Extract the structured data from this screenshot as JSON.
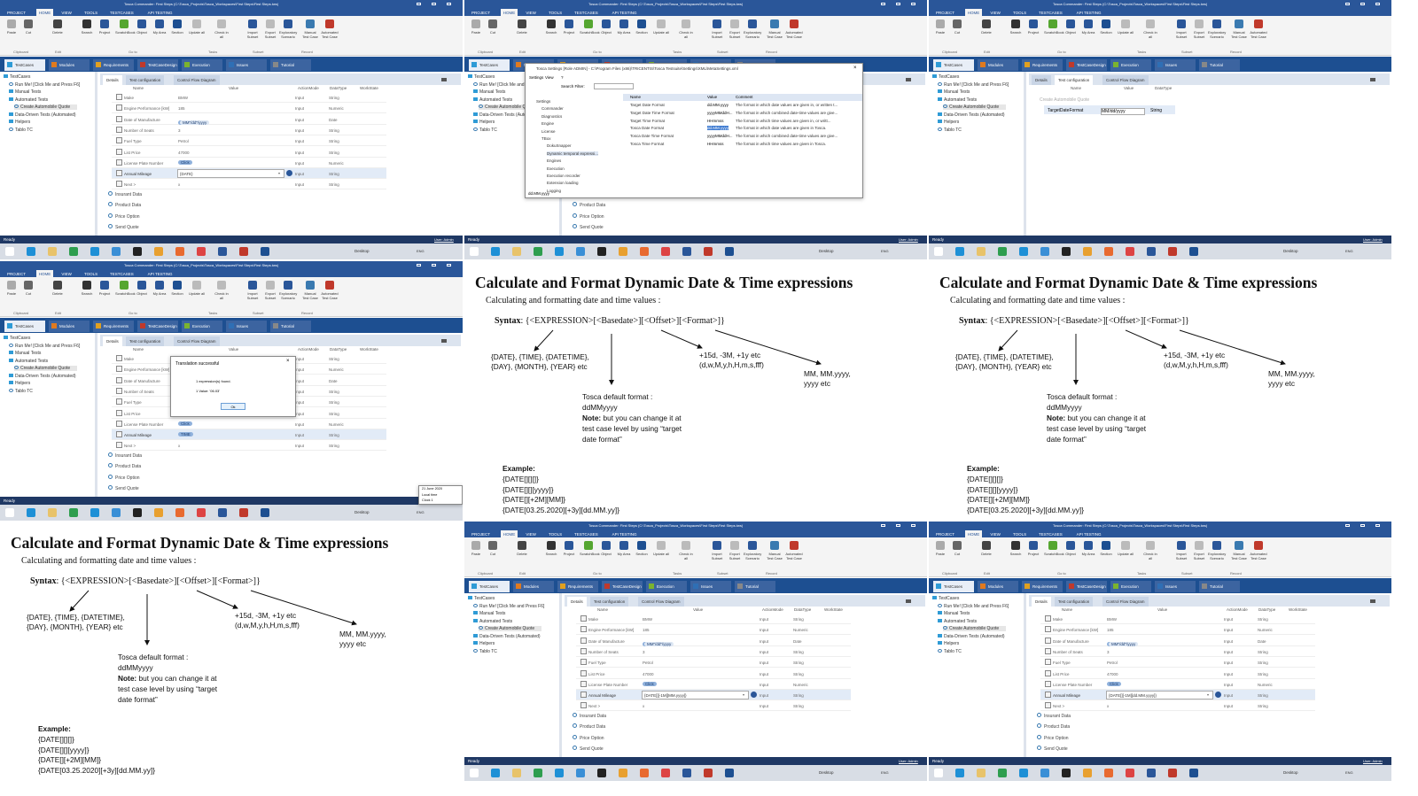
{
  "tosca": {
    "title": "Tosca Commander: First Steps (C:\\Tosca_Projects\\Tosca_Workspaces\\First Steps\\First Steps.tws)",
    "menu_tabs": [
      "PROJECT",
      "HOME",
      "VIEW",
      "TOOLS",
      "TESTCASES",
      "API TESTING"
    ],
    "ribbon": [
      "Paste",
      "Cut",
      "Delete",
      "Search",
      "Project",
      "ScratchBook",
      "Object",
      "My Area",
      "Section",
      "Update all",
      "Check in all",
      "Import Subset",
      "Export Subset",
      "Exploratory Scenario",
      "Manual Test Case",
      "Automated Test Case"
    ],
    "ribbon_groups": [
      "Clipboard",
      "Edit",
      "Go to",
      "Tasks",
      "Subset",
      "Record"
    ],
    "module_tabs": [
      "TestCases",
      "Modules",
      "Requirements",
      "TestCaseDesign",
      "Execution",
      "Issues",
      "Tutorial"
    ],
    "module_colors": [
      "#2f9bd6",
      "#e07a1f",
      "#e0a020",
      "#c0392b",
      "#7bb32e",
      "#2f6fb5",
      "#888888"
    ],
    "tree": [
      "TestCases",
      "Run Me! [Click Me and Press F6]",
      "Manual Tests",
      "Automated Tests",
      "Create Automobile Quote",
      "Data-Driven Tests (Automated)",
      "Helpers",
      "Tablo TC"
    ],
    "detail_tabs": [
      "Details",
      "Test configuration",
      "Control Flow Diagram"
    ],
    "columns": [
      "Name",
      "Value",
      "ActionMode",
      "DataType",
      "WorkState"
    ],
    "rows": [
      {
        "name": "Make",
        "value": "BMW",
        "mode": "Input",
        "type": "String"
      },
      {
        "name": "Engine Performance [kW]",
        "value": "185",
        "mode": "Input",
        "type": "Numeric"
      },
      {
        "name": "Date of Manufacture",
        "value": "DATE",
        "mode": "Input",
        "type": "Date",
        "chips": [
          "DATE",
          "-3M",
          "MM\"/dd\"/yyyy"
        ]
      },
      {
        "name": "Number of Seats",
        "value": "3",
        "mode": "Input",
        "type": "String"
      },
      {
        "name": "Fuel Type",
        "value": "Petrol",
        "mode": "Input",
        "type": "String"
      },
      {
        "name": "List Price",
        "value": "47000",
        "mode": "Input",
        "type": "String"
      },
      {
        "name": "License Plate Number",
        "value": "Click",
        "mode": "Input",
        "type": "Numeric"
      },
      {
        "name": "Annual Mileage",
        "value": "{DATE}",
        "mode": "Input",
        "type": "String"
      },
      {
        "name": "Next >",
        "value": "x",
        "mode": "Input",
        "type": "String"
      }
    ],
    "folders": [
      "Insurant Data",
      "Product Data",
      "Price Option",
      "Send Quote"
    ],
    "status": "Ready",
    "user": "User: Admin",
    "tray": [
      "Desktop",
      "ENG"
    ]
  },
  "panels": {
    "p1": {
      "mileage": "{DATE}"
    },
    "p2": {
      "settings": {
        "title": "Tosca Settings [Role ADMIN] - C:\\Program Files (x86)\\TRICENTIS\\Tosca Testsuite\\Settings\\XML\\MetaSettings.xml",
        "menu": [
          "Settings",
          "View",
          "?"
        ],
        "search_label": "Search Filter:",
        "tree": [
          "Settings",
          "Commander",
          "Diagnostics",
          "Engine",
          "License",
          "TBox",
          "DokuSnapper",
          "Dynamic temporal expressi...",
          "Engines",
          "Execution",
          "Execution recorder",
          "Extension loading",
          "Logging"
        ],
        "columns": [
          "Name",
          "Value",
          "Comment"
        ],
        "rows": [
          {
            "name": "Target Date Format",
            "value": "dd.MM.yyyy",
            "comment": "The format in which date values are given in, or written t..."
          },
          {
            "name": "Target Date Time Format",
            "value": "yyyyMMddH...",
            "comment": "The format in which combined date-time values are give..."
          },
          {
            "name": "Target Time Format",
            "value": "HHmmss",
            "comment": "The format in which time values are given in, or writt..."
          },
          {
            "name": "Tosca Date Format",
            "value": "dd.MM.yyyy",
            "comment": "The format in which date values are given in Tosca."
          },
          {
            "name": "Tosca Date Time Format",
            "value": "yyyyMMddH...",
            "comment": "The format in which combined date-time values are give..."
          },
          {
            "name": "Tosca Time Format",
            "value": "HHmmss",
            "comment": "The format in which time values are given in Tosca."
          }
        ],
        "footer": "dd.MM.yyyy"
      }
    },
    "p3": {
      "tc_root": "Create Automobile Quote",
      "tc_param": "TargetDateFormat",
      "tc_value": "MM/dd/yyyy",
      "tc_type": "String",
      "tc_columns": [
        "Name",
        "Value",
        "DataType"
      ]
    },
    "p4": {
      "dialog_title": "Translation successful",
      "line1": "1 expression(s) found.",
      "line2": "1 Value: '06.03'",
      "ok": "Ok",
      "mileage": "TIME",
      "clock": [
        "21 June 2020",
        "Local time",
        "Clock 1"
      ]
    },
    "p8": {
      "mileage": "{DATE[][-1M][MM.yyyy]}"
    },
    "p9": {
      "mileage": "{DATE[][-1M][dd.MM.yyyy]}"
    }
  },
  "slide": {
    "title": "Calculate and Format Dynamic Date & Time expressions",
    "subtitle": "Calculating and formatting date and time values :",
    "syntax_label": "Syntax",
    "syntax": ": {<EXPRESSION>[<Basedate>][<Offset>][<Format>]}",
    "expr_1": "{DATE}, {TIME}, {DATETIME},",
    "expr_2": "{DAY}, {MONTH}, {YEAR} etc",
    "offset_1": "+15d, -3M, +1y etc",
    "offset_2": "(d,w,M,y,h,H,m,s,fff)",
    "format_1": "MM, MM.yyyy,",
    "format_2": "yyyy etc",
    "default_1": "Tosca default format :",
    "default_2": "ddMMyyyy",
    "note_label": "Note:",
    "note_1": " but you can change it at",
    "note_2": "test case level by using “target",
    "note_3": "date format”",
    "example_label": "Example:",
    "examples": [
      "{DATE[][][]}",
      "{DATE[][][yyyy]}",
      "{DATE[][+2M][MM]}",
      "{DATE[03.25.2020][+3y][dd.MM.yy]}"
    ]
  }
}
